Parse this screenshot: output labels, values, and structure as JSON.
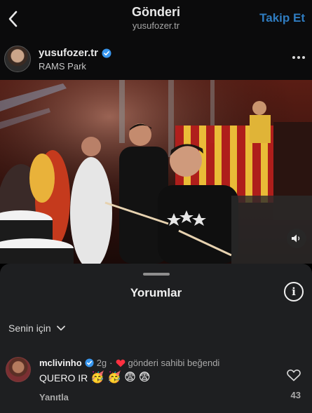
{
  "header": {
    "title": "Gönderi",
    "subtitle": "yusufozer.tr",
    "follow_label": "Takip Et"
  },
  "post": {
    "username": "yusufozer.tr",
    "location": "RAMS Park",
    "verified": true
  },
  "comments_sheet": {
    "title": "Yorumlar",
    "filter_label": "Senin için",
    "comments": [
      {
        "username": "mclivinho",
        "verified": true,
        "time": "2g",
        "separator": "·",
        "liked_by_author": "gönderi sahibi beğendi",
        "text": "QUERO IR",
        "emojis": [
          "🥳",
          "🥳",
          "😨",
          "😨"
        ],
        "reply_label": "Yanıtla",
        "like_count": "43"
      }
    ]
  },
  "colors": {
    "accent_blue": "#2f7cc0",
    "verified_blue": "#3897f0",
    "liked_heart": "#ff3040",
    "sheet_bg": "#1e1f21"
  },
  "icons": {
    "back": "chevron-left-icon",
    "more": "more-horizontal-icon",
    "volume": "speaker-icon",
    "info": "info-icon",
    "filter": "chevron-down-icon",
    "like": "heart-outline-icon"
  }
}
